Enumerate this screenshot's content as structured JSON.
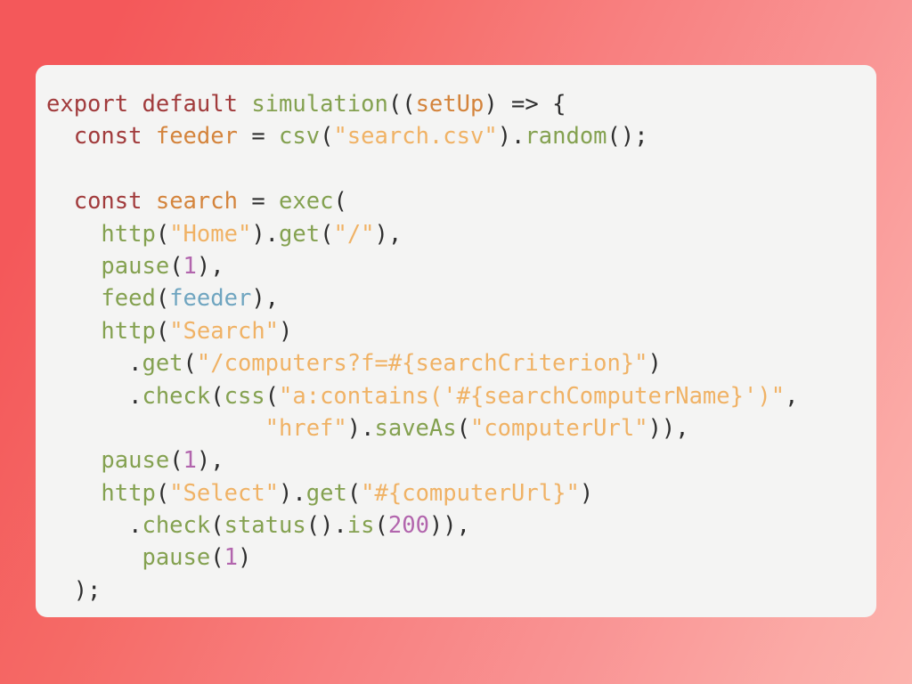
{
  "slide": {
    "background": {
      "gradient_from": "#f4585a",
      "gradient_to": "#fcb3ad",
      "direction": "diagonal-top-left-to-bottom-right"
    },
    "card": {
      "background": "#f4f4f3",
      "corner_radius_px": 13
    }
  },
  "editor": {
    "language": "javascript",
    "theme_colors": {
      "keyword": "#a13b3c",
      "function": "#84a150",
      "string": "#f0b265",
      "variable_declaration": "#d4843c",
      "variable_reference": "#6fa5c0",
      "number": "#b265ad",
      "punctuation": "#2e2e2e"
    },
    "lines": [
      {
        "n": 1,
        "text": "export default simulation((setUp) => {",
        "tokens": [
          {
            "t": "export",
            "c": "kw"
          },
          {
            "t": " ",
            "c": "pun"
          },
          {
            "t": "default",
            "c": "kw"
          },
          {
            "t": " ",
            "c": "pun"
          },
          {
            "t": "simulation",
            "c": "fn"
          },
          {
            "t": "((",
            "c": "pun"
          },
          {
            "t": "setUp",
            "c": "var"
          },
          {
            "t": ") => {",
            "c": "pun"
          }
        ]
      },
      {
        "n": 2,
        "text": "  const feeder = csv(\"search.csv\").random();",
        "tokens": [
          {
            "t": "  ",
            "c": "pun"
          },
          {
            "t": "const",
            "c": "kw"
          },
          {
            "t": " ",
            "c": "pun"
          },
          {
            "t": "feeder",
            "c": "var"
          },
          {
            "t": " = ",
            "c": "pun"
          },
          {
            "t": "csv",
            "c": "fn"
          },
          {
            "t": "(",
            "c": "pun"
          },
          {
            "t": "\"search.csv\"",
            "c": "str"
          },
          {
            "t": ").",
            "c": "pun"
          },
          {
            "t": "random",
            "c": "fn"
          },
          {
            "t": "();",
            "c": "pun"
          }
        ]
      },
      {
        "n": 3,
        "text": "",
        "tokens": []
      },
      {
        "n": 4,
        "text": "  const search = exec(",
        "tokens": [
          {
            "t": "  ",
            "c": "pun"
          },
          {
            "t": "const",
            "c": "kw"
          },
          {
            "t": " ",
            "c": "pun"
          },
          {
            "t": "search",
            "c": "var"
          },
          {
            "t": " = ",
            "c": "pun"
          },
          {
            "t": "exec",
            "c": "fn"
          },
          {
            "t": "(",
            "c": "pun"
          }
        ]
      },
      {
        "n": 5,
        "text": "    http(\"Home\").get(\"/\"),",
        "tokens": [
          {
            "t": "    ",
            "c": "pun"
          },
          {
            "t": "http",
            "c": "fn"
          },
          {
            "t": "(",
            "c": "pun"
          },
          {
            "t": "\"Home\"",
            "c": "str"
          },
          {
            "t": ").",
            "c": "pun"
          },
          {
            "t": "get",
            "c": "fn"
          },
          {
            "t": "(",
            "c": "pun"
          },
          {
            "t": "\"/\"",
            "c": "str"
          },
          {
            "t": "),",
            "c": "pun"
          }
        ]
      },
      {
        "n": 6,
        "text": "    pause(1),",
        "tokens": [
          {
            "t": "    ",
            "c": "pun"
          },
          {
            "t": "pause",
            "c": "fn"
          },
          {
            "t": "(",
            "c": "pun"
          },
          {
            "t": "1",
            "c": "num"
          },
          {
            "t": "),",
            "c": "pun"
          }
        ]
      },
      {
        "n": 7,
        "text": "    feed(feeder),",
        "tokens": [
          {
            "t": "    ",
            "c": "pun"
          },
          {
            "t": "feed",
            "c": "fn"
          },
          {
            "t": "(",
            "c": "pun"
          },
          {
            "t": "feeder",
            "c": "ref"
          },
          {
            "t": "),",
            "c": "pun"
          }
        ]
      },
      {
        "n": 8,
        "text": "    http(\"Search\")",
        "tokens": [
          {
            "t": "    ",
            "c": "pun"
          },
          {
            "t": "http",
            "c": "fn"
          },
          {
            "t": "(",
            "c": "pun"
          },
          {
            "t": "\"Search\"",
            "c": "str"
          },
          {
            "t": ")",
            "c": "pun"
          }
        ]
      },
      {
        "n": 9,
        "text": "      .get(\"/computers?f=#{searchCriterion}\")",
        "tokens": [
          {
            "t": "      .",
            "c": "pun"
          },
          {
            "t": "get",
            "c": "fn"
          },
          {
            "t": "(",
            "c": "pun"
          },
          {
            "t": "\"/computers?f=#{searchCriterion}\"",
            "c": "str"
          },
          {
            "t": ")",
            "c": "pun"
          }
        ]
      },
      {
        "n": 10,
        "text": "      .check(css(\"a:contains('#{searchComputerName}')\",",
        "tokens": [
          {
            "t": "      .",
            "c": "pun"
          },
          {
            "t": "check",
            "c": "fn"
          },
          {
            "t": "(",
            "c": "pun"
          },
          {
            "t": "css",
            "c": "fn"
          },
          {
            "t": "(",
            "c": "pun"
          },
          {
            "t": "\"a:contains('#{searchComputerName}')\"",
            "c": "str"
          },
          {
            "t": ",",
            "c": "pun"
          }
        ]
      },
      {
        "n": 11,
        "text": "                \"href\").saveAs(\"computerUrl\")),",
        "tokens": [
          {
            "t": "                ",
            "c": "pun"
          },
          {
            "t": "\"href\"",
            "c": "str"
          },
          {
            "t": ").",
            "c": "pun"
          },
          {
            "t": "saveAs",
            "c": "fn"
          },
          {
            "t": "(",
            "c": "pun"
          },
          {
            "t": "\"computerUrl\"",
            "c": "str"
          },
          {
            "t": ")),",
            "c": "pun"
          }
        ]
      },
      {
        "n": 12,
        "text": "    pause(1),",
        "tokens": [
          {
            "t": "    ",
            "c": "pun"
          },
          {
            "t": "pause",
            "c": "fn"
          },
          {
            "t": "(",
            "c": "pun"
          },
          {
            "t": "1",
            "c": "num"
          },
          {
            "t": "),",
            "c": "pun"
          }
        ]
      },
      {
        "n": 13,
        "text": "    http(\"Select\").get(\"#{computerUrl}\")",
        "tokens": [
          {
            "t": "    ",
            "c": "pun"
          },
          {
            "t": "http",
            "c": "fn"
          },
          {
            "t": "(",
            "c": "pun"
          },
          {
            "t": "\"Select\"",
            "c": "str"
          },
          {
            "t": ").",
            "c": "pun"
          },
          {
            "t": "get",
            "c": "fn"
          },
          {
            "t": "(",
            "c": "pun"
          },
          {
            "t": "\"#{computerUrl}\"",
            "c": "str"
          },
          {
            "t": ")",
            "c": "pun"
          }
        ]
      },
      {
        "n": 14,
        "text": "      .check(status().is(200)),",
        "tokens": [
          {
            "t": "      .",
            "c": "pun"
          },
          {
            "t": "check",
            "c": "fn"
          },
          {
            "t": "(",
            "c": "pun"
          },
          {
            "t": "status",
            "c": "fn"
          },
          {
            "t": "().",
            "c": "pun"
          },
          {
            "t": "is",
            "c": "fn"
          },
          {
            "t": "(",
            "c": "pun"
          },
          {
            "t": "200",
            "c": "num"
          },
          {
            "t": ")),",
            "c": "pun"
          }
        ]
      },
      {
        "n": 15,
        "text": "       pause(1)",
        "tokens": [
          {
            "t": "       ",
            "c": "pun"
          },
          {
            "t": "pause",
            "c": "fn"
          },
          {
            "t": "(",
            "c": "pun"
          },
          {
            "t": "1",
            "c": "num"
          },
          {
            "t": ")",
            "c": "pun"
          }
        ]
      },
      {
        "n": 16,
        "text": "  );",
        "tokens": [
          {
            "t": "  );",
            "c": "pun"
          }
        ]
      }
    ]
  }
}
